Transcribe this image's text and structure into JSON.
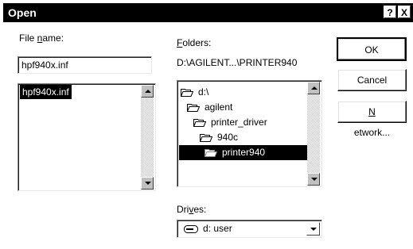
{
  "window": {
    "title": "Open",
    "help_label": "?",
    "close_label": "X"
  },
  "file_name": {
    "label_pre": "File ",
    "label_mnemonic": "n",
    "label_post": "ame:",
    "value": "hpf940x.inf",
    "list": [
      "hpf940x.inf"
    ]
  },
  "folders": {
    "label_mnemonic": "F",
    "label_post": "olders:",
    "path": "D:\\AGILENT...\\PRINTER940",
    "items": [
      {
        "label": "d:\\",
        "icon": "open-folder-icon"
      },
      {
        "label": "agilent",
        "icon": "open-folder-icon"
      },
      {
        "label": "printer_driver",
        "icon": "open-folder-icon"
      },
      {
        "label": "940c",
        "icon": "open-folder-icon"
      },
      {
        "label": "printer940",
        "icon": "open-folder-icon",
        "selected": true
      }
    ]
  },
  "drives": {
    "label_pre": "Dri",
    "label_mnemonic": "v",
    "label_post": "es:",
    "value": "d: user",
    "icon": "drive-icon"
  },
  "buttons": {
    "ok": "OK",
    "cancel": "Cancel",
    "network_pre": "",
    "network_mnemonic": "N",
    "network_post": "etwork..."
  }
}
